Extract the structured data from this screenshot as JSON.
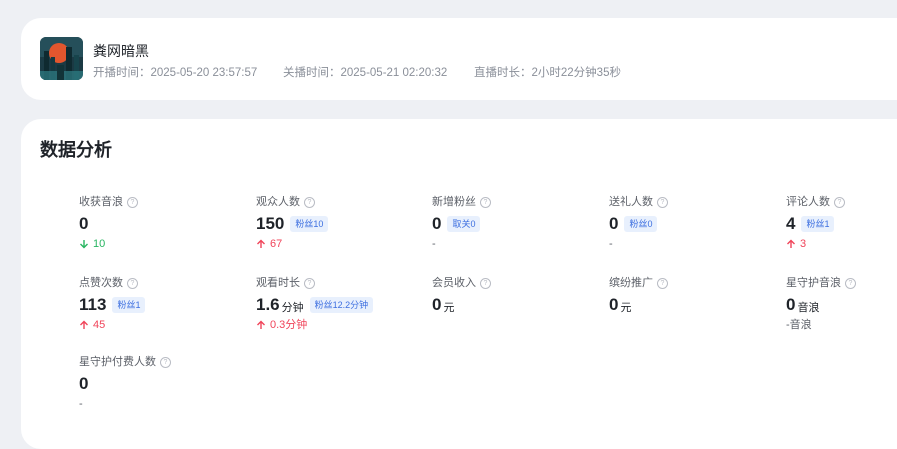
{
  "live": {
    "title": "粪网暗黑",
    "start_label": "开播时间：",
    "start_value": "2025-05-20 23:57:57",
    "end_label": "关播时间：",
    "end_value": "2025-05-21 02:20:32",
    "duration_label": "直播时长：",
    "duration_value": "2小时22分钟35秒",
    "avatar_icon": "city-sunset-avatar"
  },
  "section_title": "数据分析",
  "metrics": [
    {
      "label": "收获音浪",
      "value": "0",
      "unit": "",
      "badge": "",
      "change": "10",
      "trend": "down"
    },
    {
      "label": "观众人数",
      "value": "150",
      "unit": "",
      "badge": "粉丝10",
      "change": "67",
      "trend": "up"
    },
    {
      "label": "新增粉丝",
      "value": "0",
      "unit": "",
      "badge": "取关0",
      "change": "-",
      "trend": "flat"
    },
    {
      "label": "送礼人数",
      "value": "0",
      "unit": "",
      "badge": "粉丝0",
      "change": "-",
      "trend": "flat"
    },
    {
      "label": "评论人数",
      "value": "4",
      "unit": "",
      "badge": "粉丝1",
      "change": "3",
      "trend": "up"
    },
    {
      "label": "点赞次数",
      "value": "113",
      "unit": "",
      "badge": "粉丝1",
      "change": "45",
      "trend": "up"
    },
    {
      "label": "观看时长",
      "value": "1.6",
      "unit": "分钟",
      "badge": "粉丝12.2分钟",
      "change": "0.3分钟",
      "trend": "up"
    },
    {
      "label": "会员收入",
      "value": "0",
      "unit": "元",
      "badge": "",
      "change": "",
      "trend": "none"
    },
    {
      "label": "缤纷推广",
      "value": "0",
      "unit": "元",
      "badge": "",
      "change": "",
      "trend": "none"
    },
    {
      "label": "星守护音浪",
      "value": "0",
      "unit": "音浪",
      "badge": "",
      "change": "-音浪",
      "trend": "flat"
    },
    {
      "label": "星守护付费人数",
      "value": "0",
      "unit": "",
      "badge": "",
      "change": "-",
      "trend": "flat"
    }
  ],
  "colors": {
    "up": "#f0445a",
    "down": "#28b561",
    "badge_bg": "#e8f0fd",
    "badge_text": "#3d6fe0"
  }
}
